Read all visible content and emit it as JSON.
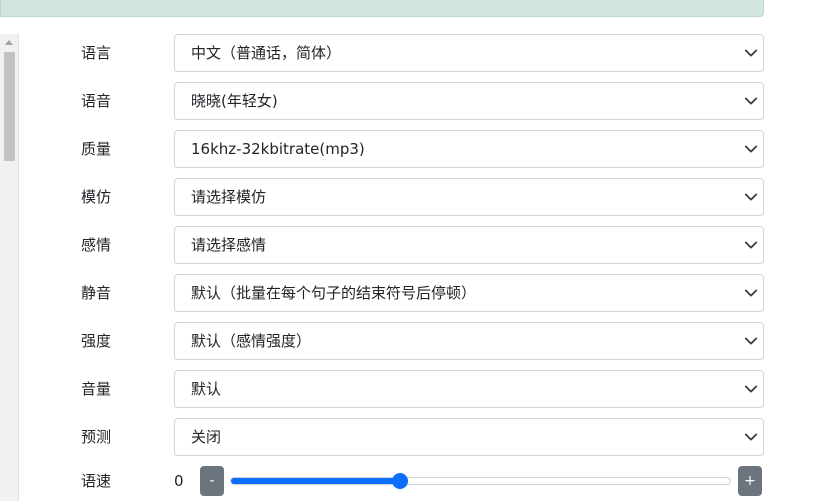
{
  "form": {
    "rows": [
      {
        "label": "语言",
        "value": "中文（普通话，简体）"
      },
      {
        "label": "语音",
        "value": "晓晓(年轻女)"
      },
      {
        "label": "质量",
        "value": "16khz-32kbitrate(mp3)"
      },
      {
        "label": "模仿",
        "value": "请选择模仿"
      },
      {
        "label": "感情",
        "value": "请选择感情"
      },
      {
        "label": "静音",
        "value": "默认（批量在每个句子的结束符号后停顿）"
      },
      {
        "label": "强度",
        "value": "默认（感情强度）"
      },
      {
        "label": "音量",
        "value": "默认"
      },
      {
        "label": "预测",
        "value": "关闭"
      }
    ],
    "speed": {
      "label": "语速",
      "value": "0",
      "minus_label": "-",
      "plus_label": "+",
      "position_fraction": 0.338
    }
  },
  "colors": {
    "alert_bg": "#d1e7dd",
    "accent": "#0d6efd",
    "button": "#6c757d"
  },
  "icons": {
    "select_arrow": "chevron-down-icon"
  }
}
